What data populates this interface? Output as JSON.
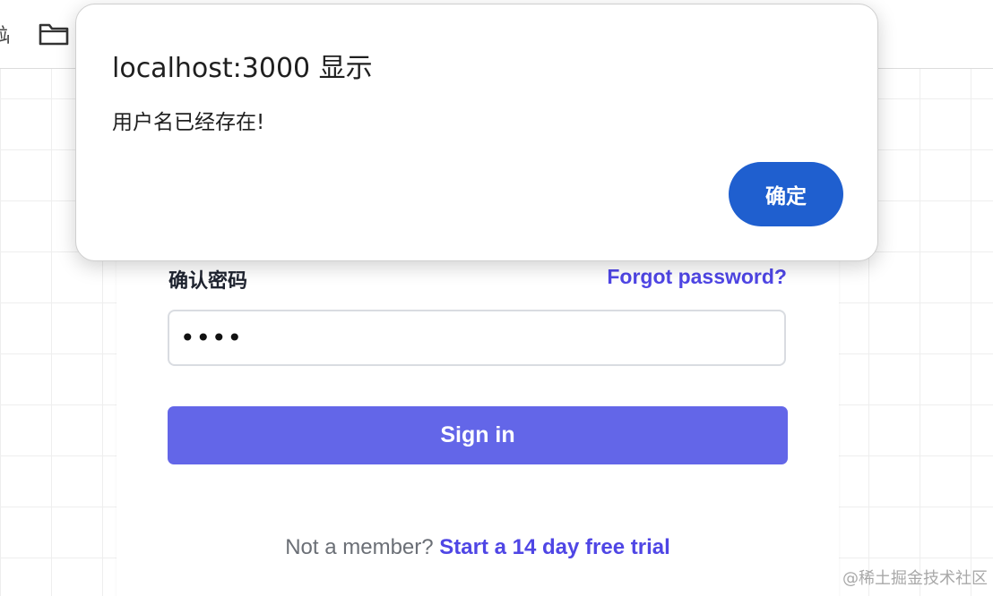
{
  "bookmark_bar": {
    "partial_text": "站",
    "folder_icon": "folder-icon"
  },
  "alert": {
    "title": "localhost:3000 显示",
    "message": "用户名已经存在!",
    "ok_label": "确定"
  },
  "login_form": {
    "confirm_password_label": "确认密码",
    "forgot_password_link": "Forgot password?",
    "password_value": "••••",
    "sign_in_label": "Sign in",
    "not_member_text": "Not a member?",
    "trial_link": "Start a 14 day free trial"
  },
  "watermark": "@稀土掘金技术社区",
  "colors": {
    "accent": "#4f46e5",
    "primary_button": "#6366e8",
    "dialog_button": "#1f5fcf"
  }
}
